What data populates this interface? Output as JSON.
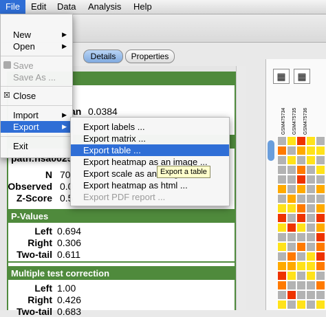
{
  "menubar": {
    "items": [
      "File",
      "Edit",
      "Data",
      "Analysis",
      "Help"
    ]
  },
  "tabs": {
    "details": "Details",
    "properties": "Properties"
  },
  "file_menu": {
    "new": "New",
    "open": "Open",
    "save": "Save",
    "save_as": "Save As ...",
    "close": "Close",
    "import": "Import",
    "export": "Export",
    "exit": "Exit"
  },
  "export_menu": {
    "items": [
      "Export labels ...",
      "Export matrix ...",
      "Export table ...",
      "Export heatmap as an image ...",
      "Export scale as an image ...",
      "Export heatmap as html ...",
      "Export PDF report ..."
    ]
  },
  "tooltip": "Export a table",
  "details": {
    "partial_value_label": "an",
    "partial_value": "0.0384",
    "path_label": "path:hsa0025",
    "n_label": "N",
    "n_value": "70",
    "observed_label": "Observed",
    "observed_value": "0.0",
    "zscore_label": "Z-Score",
    "zscore_value": "0.5"
  },
  "pvalues": {
    "title": "P-Values",
    "left_label": "Left",
    "left_value": "0.694",
    "right_label": "Right",
    "right_value": "0.306",
    "twotail_label": "Two-tail",
    "twotail_value": "0.611"
  },
  "mtc": {
    "title": "Multiple test correction",
    "left_label": "Left",
    "left_value": "1.00",
    "right_label": "Right",
    "right_value": "0.426",
    "twotail_label": "Two-tail",
    "twotail_value": "0.683"
  },
  "heatmap": {
    "columns": [
      "GSM475734",
      "GSM475735",
      "GSM475736"
    ],
    "colors": {
      "grey": "#b3b3b3",
      "yellow": "#ffe21a",
      "orange": "#ffaa00",
      "red": "#ee3300",
      "darkorange": "#ff7a00"
    }
  }
}
